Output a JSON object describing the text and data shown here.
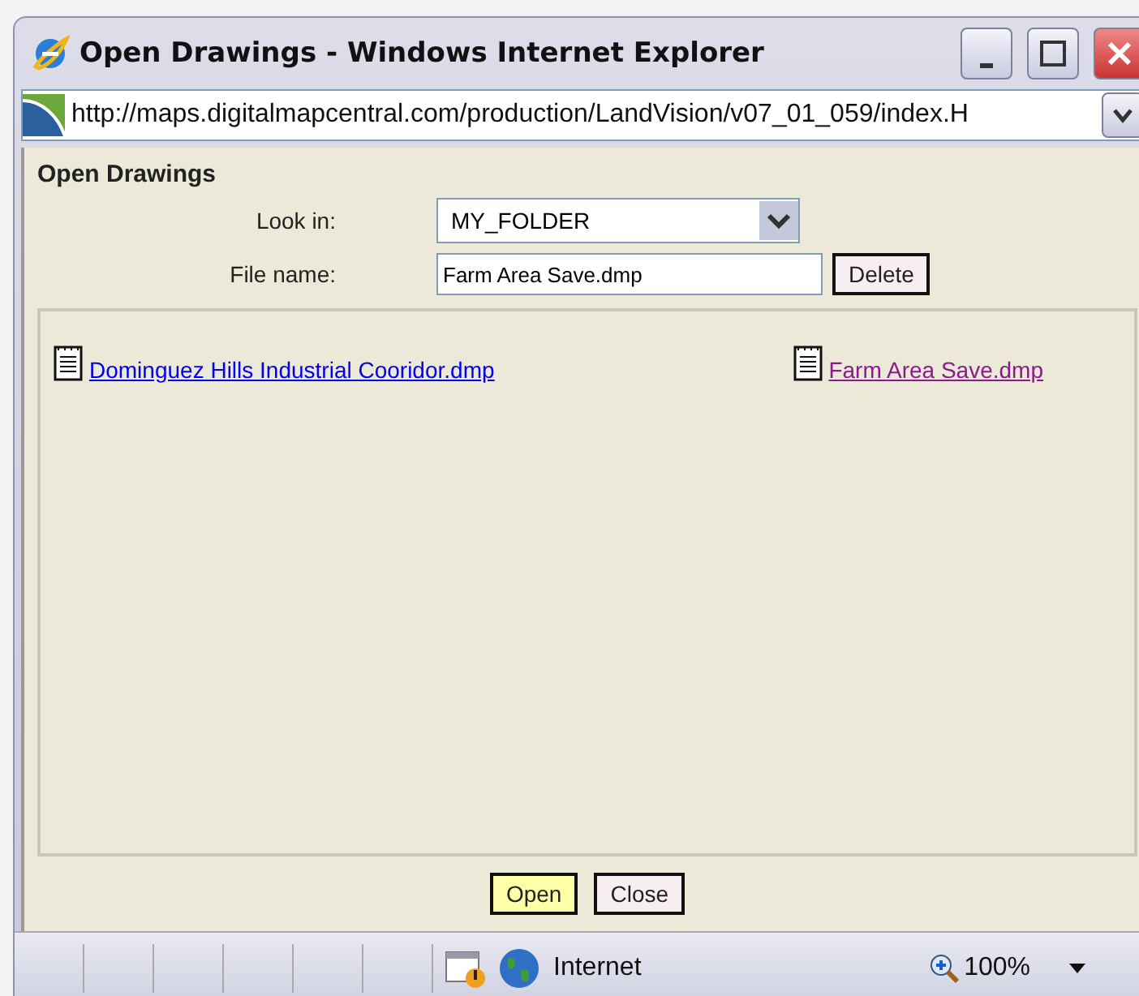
{
  "window": {
    "title": "Open Drawings - Windows Internet Explorer"
  },
  "address": {
    "url": "http://maps.digitalmapcentral.com/production/LandVision/v07_01_059/index.H"
  },
  "dialog": {
    "heading": "Open Drawings",
    "look_in_label": "Look in:",
    "look_in_value": "MY_FOLDER",
    "file_name_label": "File name:",
    "file_name_value": "Farm Area Save.dmp",
    "delete_button": "Delete"
  },
  "files": [
    {
      "name": "Dominguez Hills Industrial Cooridor.dmp",
      "visited": false
    },
    {
      "name": "Farm Area Save.dmp",
      "visited": true
    }
  ],
  "buttons": [
    {
      "label": "Open",
      "default": true
    },
    {
      "label": "Close",
      "default": false
    }
  ],
  "status_bar": {
    "zone": "Internet",
    "zoom": "100%"
  }
}
